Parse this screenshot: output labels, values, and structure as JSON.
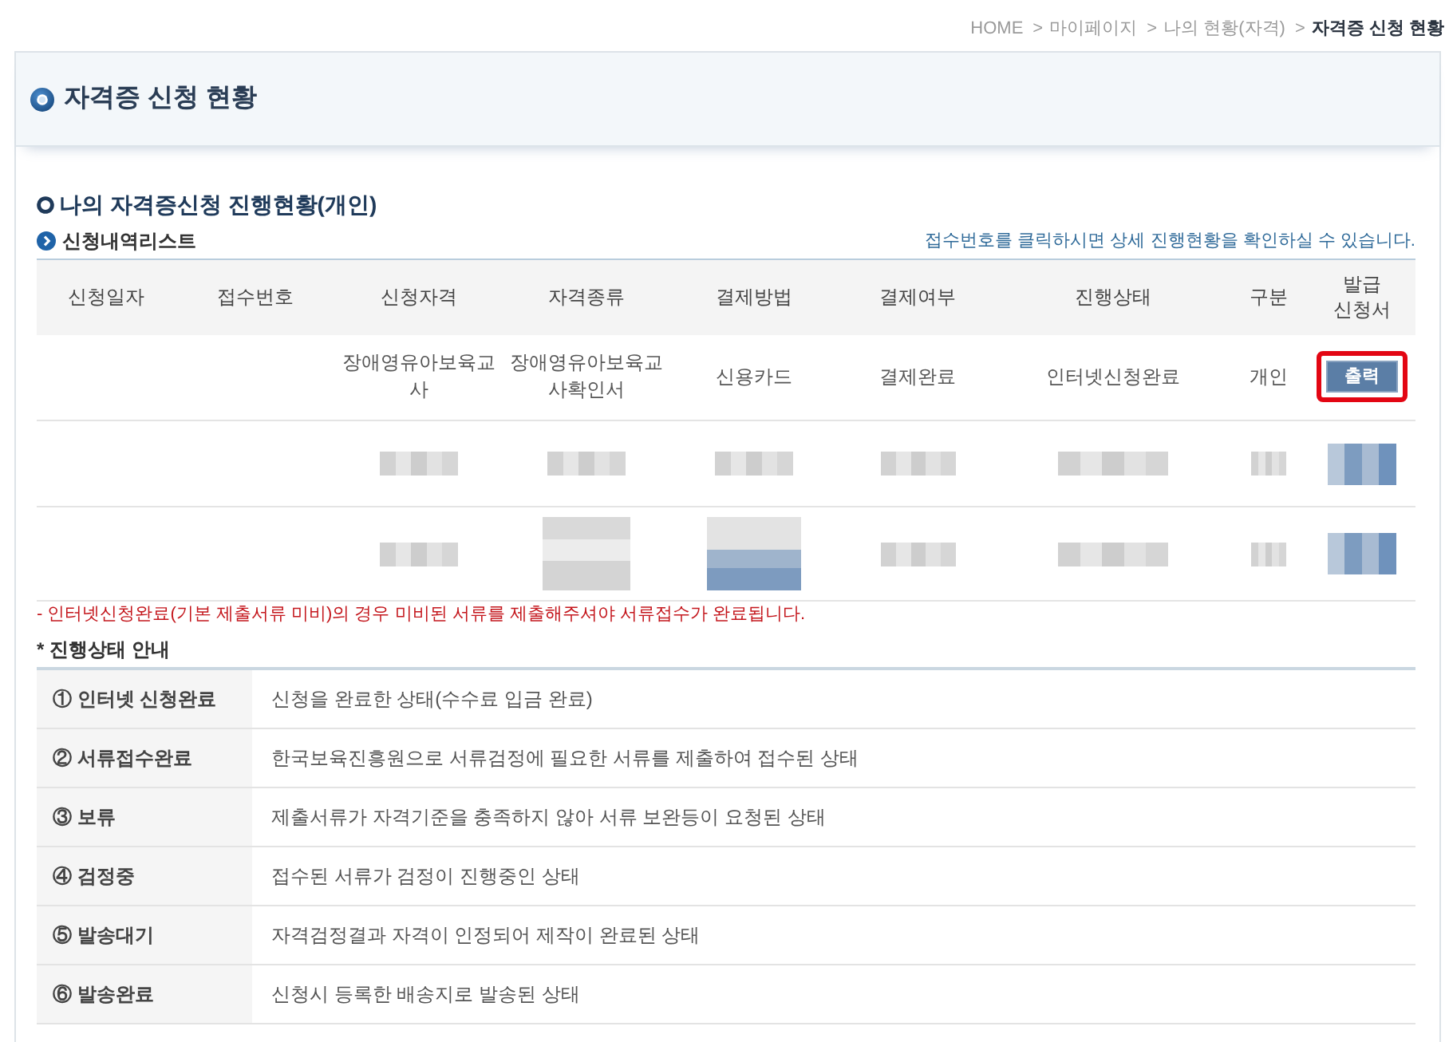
{
  "breadcrumb": [
    {
      "label": "HOME",
      "current": false
    },
    {
      "separator": ">",
      "label": "마이페이지",
      "current": false
    },
    {
      "separator": ">",
      "label": "나의 현황(자격)",
      "current": false
    },
    {
      "separator": ">",
      "label": "자격증 신청 현황",
      "current": true
    }
  ],
  "page_title": "자격증 신청 현황",
  "section_title": "나의 자격증신청 진행현황(개인)",
  "list": {
    "title": "신청내역리스트",
    "hint": "접수번호를 클릭하시면 상세 진행현황을 확인하실 수 있습니다.",
    "columns": [
      "신청일자",
      "접수번호",
      "신청자격",
      "자격종류",
      "결제방법",
      "결제여부",
      "진행상태",
      "구분",
      "발급 신청서"
    ],
    "rows": [
      {
        "cells": [
          {
            "kind": "empty"
          },
          {
            "kind": "empty"
          },
          {
            "kind": "text",
            "text": "장애영유아보육교사"
          },
          {
            "kind": "text",
            "text": "장애영유아보육교사확인서"
          },
          {
            "kind": "text",
            "text": "신용카드"
          },
          {
            "kind": "text",
            "text": "결제완료"
          },
          {
            "kind": "text",
            "text": "인터넷신청완료"
          },
          {
            "kind": "text",
            "text": "개인"
          },
          {
            "kind": "button",
            "label": "출력",
            "highlighted": true
          }
        ]
      },
      {
        "cells": [
          {
            "kind": "empty"
          },
          {
            "kind": "empty"
          },
          {
            "kind": "redacted"
          },
          {
            "kind": "redacted"
          },
          {
            "kind": "redacted"
          },
          {
            "kind": "redacted"
          },
          {
            "kind": "redacted"
          },
          {
            "kind": "redacted"
          },
          {
            "kind": "redacted_button"
          }
        ]
      },
      {
        "cells": [
          {
            "kind": "empty"
          },
          {
            "kind": "empty"
          },
          {
            "kind": "redacted"
          },
          {
            "kind": "redacted_tall"
          },
          {
            "kind": "redacted_link"
          },
          {
            "kind": "redacted"
          },
          {
            "kind": "redacted"
          },
          {
            "kind": "redacted"
          },
          {
            "kind": "redacted_button"
          }
        ]
      }
    ]
  },
  "notice": "- 인터넷신청완료(기본 제출서류 미비)의 경우 미비된 서류를 제출해주셔야 서류접수가 완료됩니다.",
  "guide": {
    "title": "* 진행상태 안내",
    "rows": [
      {
        "status": "① 인터넷 신청완료",
        "description": "신청을 완료한 상태(수수료 입금 완료)"
      },
      {
        "status": "② 서류접수완료",
        "description": "한국보육진흥원으로 서류검정에 필요한 서류를 제출하여 접수된 상태"
      },
      {
        "status": "③ 보류",
        "description": "제출서류가 자격기준을 충족하지 않아 서류 보완등이 요청된 상태"
      },
      {
        "status": "④ 검정중",
        "description": "접수된 서류가 검정이 진행중인 상태"
      },
      {
        "status": "⑤ 발송대기",
        "description": "자격검정결과 자격이 인정되어 제작이 완료된 상태"
      },
      {
        "status": "⑥ 발송완료",
        "description": "신청시 등록한 배송지로 발송된 상태"
      }
    ]
  }
}
